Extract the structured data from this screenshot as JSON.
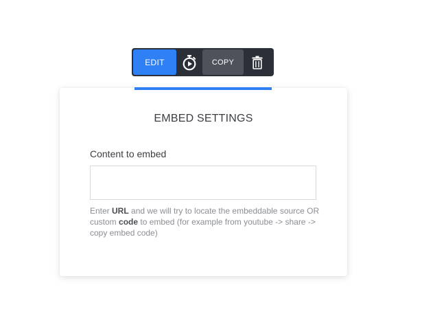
{
  "toolbar": {
    "edit_label": "EDIT",
    "copy_label": "COPY",
    "timer_icon": "stopwatch-icon",
    "trash_icon": "trash-icon"
  },
  "colors": {
    "accent": "#2f80f5",
    "toolbar_bg": "#2b2f37",
    "copy_bg": "#4d525b"
  },
  "panel": {
    "title": "EMBED SETTINGS",
    "field_label": "Content to embed",
    "field_value": "",
    "help": {
      "part1": "Enter ",
      "url_word": "URL",
      "part2": " and we will try to locate the embeddable source OR custom ",
      "code_word": "code",
      "part3": " to embed (for example from youtube -> share -> copy embed code)"
    }
  }
}
